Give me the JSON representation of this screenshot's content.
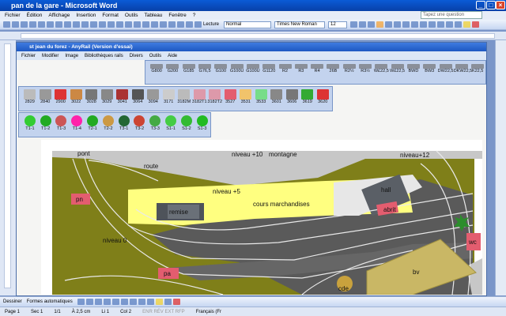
{
  "word": {
    "title": "pan de la gare - Microsoft Word",
    "menu": [
      "Fichier",
      "Édition",
      "Affichage",
      "Insertion",
      "Format",
      "Outils",
      "Tableau",
      "Fenêtre",
      "?"
    ],
    "help_placeholder": "Tapez une question",
    "style": "Normal",
    "font": "Times New Roman",
    "size": "12",
    "reading_label": "Lecture"
  },
  "anyrail": {
    "title": "st jean du forez - AnyRail (Version d'essai)",
    "menu": [
      "Fichier",
      "Modifier",
      "Image",
      "Bibliothèques rails",
      "Divers",
      "Outils",
      "Aide"
    ],
    "palette1": [
      "G800",
      "G200",
      "G185",
      "G76,5",
      "G100",
      "G100U",
      "G100U",
      "G1120",
      "R2",
      "R3",
      "R4",
      "26B",
      "R2½",
      "R3½",
      "W£22,5",
      "W£22,5",
      "BWD",
      "BW3",
      "DW22,5",
      "DKW22,5",
      "K22,5"
    ],
    "palette2": [
      "2829",
      "2840",
      "2900",
      "3022",
      "3028",
      "3029",
      "3041",
      "3064",
      "3094",
      "3171",
      "3182M",
      "3182T1",
      "3182T2",
      "3527",
      "3531",
      "3533",
      "3601",
      "3606",
      "3619",
      "3620"
    ],
    "palette3": [
      "T1-1",
      "T1-2",
      "T1-3",
      "T1-4",
      "T2-1",
      "T2-2",
      "T3-1",
      "T3-2",
      "T3-3",
      "S1-1",
      "S1-2",
      "S1-3"
    ]
  },
  "layout_labels": {
    "pont": "pont",
    "route": "route",
    "niveau10": "niveau +10",
    "montagne": "montagne",
    "niveau12": "niveau+12",
    "niveau5": "niveau +5",
    "cours": "cours marchandises",
    "hall": "hall",
    "pn": "pn",
    "remise": "remise",
    "abri": "abrit",
    "niveau0": "niveau 0",
    "wc": "wc",
    "pa": "pa",
    "bv": "bv",
    "cde": "cde"
  },
  "draw_bar": {
    "draw": "Dessiner",
    "autoshapes": "Formes automatiques"
  },
  "status": {
    "page": "Page 1",
    "section": "Sec 1",
    "pages": "1/1",
    "at": "À 2,5 cm",
    "line": "Li 1",
    "col": "Col 2",
    "flags": "ENR  RÉV  EXT  RFP",
    "lang": "Français (Fr"
  },
  "colors": {
    "grass": "#7f7f19",
    "track_area": "#5a5a5a",
    "road": "#c7c7c7",
    "yard": "#ffff80",
    "building_red": "#e35d6f",
    "bv": "#c9b765"
  }
}
